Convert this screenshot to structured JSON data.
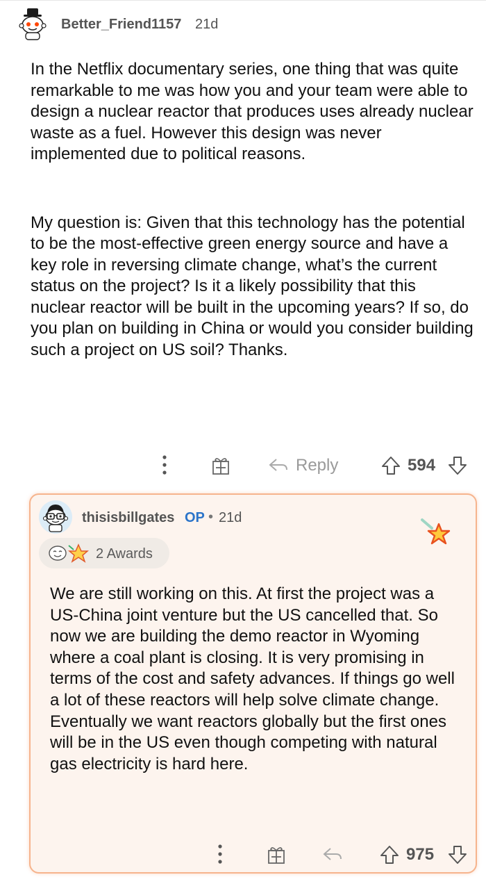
{
  "top_comment": {
    "username": "Better_Friend1157",
    "age": "21d",
    "paragraphs": [
      "In the Netflix documentary series, one thing that was quite remarkable to me was how you and your team were able to design a nuclear reactor that produces uses already nuclear waste as a fuel. However this design was never implemented due to political reasons.",
      "My question is: Given that this technology has the potential to be the most-effective green energy source and have a key role in reversing climate change, what’s the current status on the project? Is it a likely possibility that this nuclear reactor will be built in the upcoming years? If so, do you plan on building in China or would you consider building such a project on US soil? Thanks."
    ],
    "actions": {
      "more_icon": "more-vertical-icon",
      "gift_icon": "gift-icon",
      "reply_label": "Reply",
      "vote_count": "594"
    }
  },
  "reply": {
    "username": "thisisbillgates",
    "op_tag": "OP",
    "separator": "•",
    "age": "21d",
    "awards_label": "2 Awards",
    "paragraphs": [
      "We are still working on this. At first the project was a US-China joint venture but the US cancelled that. So now we are building the demo reactor in Wyoming where a coal plant is closing. It is very promising in terms of the cost and safety advances. If things go well a lot of these reactors will help solve climate change. Eventually we want reactors globally but the first ones will be in the US even though competing with natural gas electricity is hard here."
    ],
    "actions": {
      "vote_count": "975"
    }
  },
  "colors": {
    "card_bg": "#fdf4ee",
    "card_border": "#f6b48d",
    "op_blue": "#2b74c9",
    "muted": "#9a9a9a"
  }
}
